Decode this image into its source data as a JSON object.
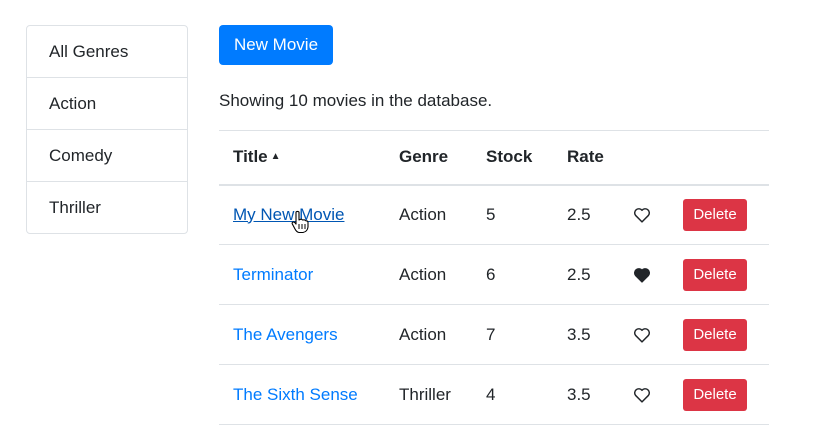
{
  "genres": {
    "items": [
      {
        "label": "All Genres"
      },
      {
        "label": "Action"
      },
      {
        "label": "Comedy"
      },
      {
        "label": "Thriller"
      }
    ]
  },
  "toolbar": {
    "new_movie_label": "New Movie"
  },
  "summary": "Showing 10 movies in the database.",
  "table": {
    "headers": {
      "title": "Title",
      "genre": "Genre",
      "stock": "Stock",
      "rate": "Rate"
    },
    "sort_indicator": "▲",
    "delete_label": "Delete",
    "rows": [
      {
        "title": "My New Movie",
        "genre": "Action",
        "stock": "5",
        "rate": "2.5",
        "liked": false
      },
      {
        "title": "Terminator",
        "genre": "Action",
        "stock": "6",
        "rate": "2.5",
        "liked": true
      },
      {
        "title": "The Avengers",
        "genre": "Action",
        "stock": "7",
        "rate": "3.5",
        "liked": false
      },
      {
        "title": "The Sixth Sense",
        "genre": "Thriller",
        "stock": "4",
        "rate": "3.5",
        "liked": false
      }
    ]
  },
  "colors": {
    "primary": "#007bff",
    "danger": "#dc3545",
    "border": "#dee2e6"
  },
  "icons": {
    "like": "heart-icon",
    "pointer": "hand-cursor-icon"
  }
}
